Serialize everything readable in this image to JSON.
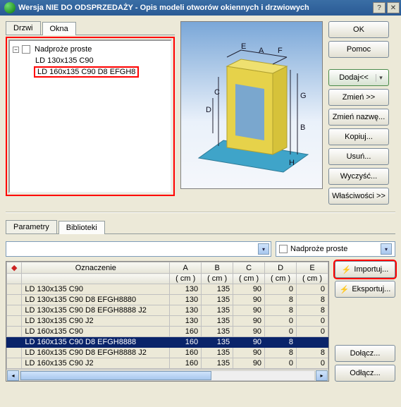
{
  "window": {
    "title": "Wersja NIE DO ODSPRZEDAŻY - Opis modeli otworów okiennych i drzwiowych"
  },
  "top_tabs": {
    "drzwi": "Drzwi",
    "okna": "Okna"
  },
  "tree": {
    "root": "Nadproże proste",
    "items": [
      "LD 130x135 C90",
      "LD 160x135 C90 D8 EFGH8"
    ]
  },
  "right_buttons": {
    "ok": "OK",
    "pomoc": "Pomoc",
    "dodaj": "Dodaj<<",
    "zmien": "Zmień >>",
    "zmien_nazwe": "Zmień nazwę...",
    "kopiuj": "Kopiuj...",
    "usun": "Usuń...",
    "wyczysc": "Wyczyść...",
    "wlasciwosci": "Właściwości >>"
  },
  "bottom_tabs": {
    "parametry": "Parametry",
    "biblioteki": "Biblioteki"
  },
  "dropdown": {
    "label": "Nadproże proste"
  },
  "side_buttons": {
    "importuj": "Importuj...",
    "eksportuj": "Eksportuj...",
    "dolacz": "Dołącz...",
    "odlacz": "Odłącz..."
  },
  "grid": {
    "columns": [
      "",
      "Oznaczenie",
      "A",
      "B",
      "C",
      "D",
      "E"
    ],
    "units": [
      "",
      "",
      "( cm )",
      "( cm )",
      "( cm )",
      "( cm )",
      "( cm )"
    ],
    "rows": [
      {
        "label": "LD 130x135 C90",
        "A": 130,
        "B": 135,
        "C": 90,
        "D": 0,
        "E": 0
      },
      {
        "label": "LD 130x135 C90 D8 EFGH8880",
        "A": 130,
        "B": 135,
        "C": 90,
        "D": 8,
        "E": 8
      },
      {
        "label": "LD 130x135 C90 D8 EFGH8888 J2",
        "A": 130,
        "B": 135,
        "C": 90,
        "D": 8,
        "E": 8
      },
      {
        "label": "LD 130x135 C90 J2",
        "A": 130,
        "B": 135,
        "C": 90,
        "D": 0,
        "E": 0
      },
      {
        "label": "LD 160x135 C90",
        "A": 160,
        "B": 135,
        "C": 90,
        "D": 0,
        "E": 0
      },
      {
        "label": "LD 160x135 C90 D8 EFGH8888",
        "A": 160,
        "B": 135,
        "C": 90,
        "D": 8,
        "E": ""
      },
      {
        "label": "LD 160x135 C90 D8 EFGH8888 J2",
        "A": 160,
        "B": 135,
        "C": 90,
        "D": 8,
        "E": 8
      },
      {
        "label": "LD 160x135 C90 J2",
        "A": 160,
        "B": 135,
        "C": 90,
        "D": 0,
        "E": 0
      }
    ],
    "selected_index": 5
  }
}
